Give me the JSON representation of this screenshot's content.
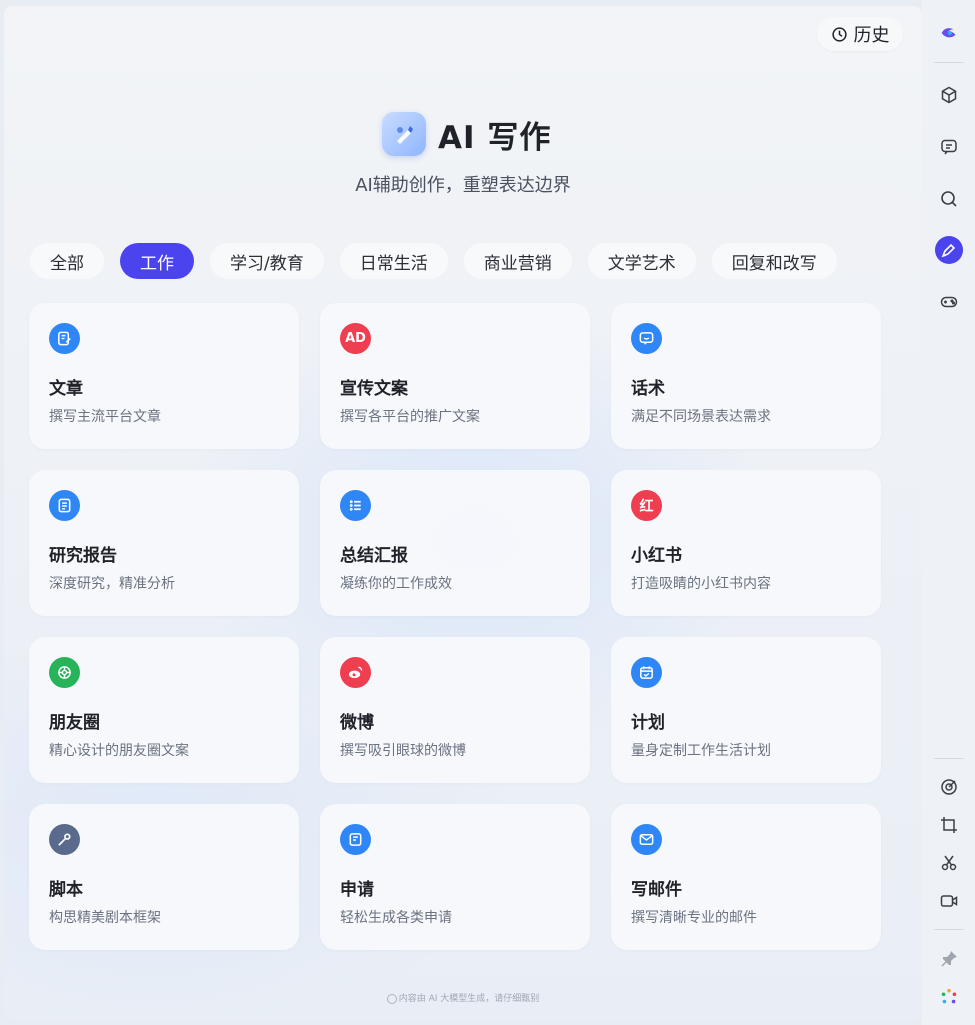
{
  "header": {
    "history_label": "历史"
  },
  "hero": {
    "title": "AI 写作",
    "subtitle": "AI辅助创作，重塑表达边界"
  },
  "tabs": [
    {
      "label": "全部",
      "active": false
    },
    {
      "label": "工作",
      "active": true
    },
    {
      "label": "学习/教育",
      "active": false
    },
    {
      "label": "日常生活",
      "active": false
    },
    {
      "label": "商业营销",
      "active": false
    },
    {
      "label": "文学艺术",
      "active": false
    },
    {
      "label": "回复和改写",
      "active": false
    }
  ],
  "cards": [
    {
      "title": "文章",
      "desc": "撰写主流平台文章",
      "icon": "article-icon",
      "color": "#2f86f6"
    },
    {
      "title": "宣传文案",
      "desc": "撰写各平台的推广文案",
      "icon": "ad-icon",
      "icon_text": "AD",
      "color": "#ee3e4f"
    },
    {
      "title": "话术",
      "desc": "满足不同场景表达需求",
      "icon": "chat-smile-icon",
      "color": "#2f86f6"
    },
    {
      "title": "研究报告",
      "desc": "深度研究，精准分析",
      "icon": "report-icon",
      "color": "#2f86f6"
    },
    {
      "title": "总结汇报",
      "desc": "凝练你的工作成效",
      "icon": "list-icon",
      "color": "#2f86f6"
    },
    {
      "title": "小红书",
      "desc": "打造吸睛的小红书内容",
      "icon": "xiaohongshu-icon",
      "icon_text": "红",
      "color": "#ee3e4f"
    },
    {
      "title": "朋友圈",
      "desc": "精心设计的朋友圈文案",
      "icon": "moments-icon",
      "color": "#27b35a"
    },
    {
      "title": "微博",
      "desc": "撰写吸引眼球的微博",
      "icon": "weibo-icon",
      "color": "#ee3e4f"
    },
    {
      "title": "计划",
      "desc": "量身定制工作生活计划",
      "icon": "calendar-icon",
      "color": "#2f86f6"
    },
    {
      "title": "脚本",
      "desc": "构思精美剧本框架",
      "icon": "script-icon",
      "color": "#5a6a8c"
    },
    {
      "title": "申请",
      "desc": "轻松生成各类申请",
      "icon": "application-icon",
      "color": "#2f86f6"
    },
    {
      "title": "写邮件",
      "desc": "撰写清晰专业的邮件",
      "icon": "mail-icon",
      "color": "#2f86f6"
    }
  ],
  "footer": {
    "note": "内容由 AI 大模型生成，请仔细甄别"
  },
  "rail": {
    "items": [
      "logo-icon",
      "cube-icon",
      "chat-icon",
      "search-icon",
      "pen-icon",
      "gamepad-icon",
      "target-icon",
      "crop-icon",
      "scissors-icon",
      "video-icon",
      "pin-icon",
      "apps-icon"
    ],
    "active": "pen-icon",
    "accent": "#4b44ee"
  }
}
